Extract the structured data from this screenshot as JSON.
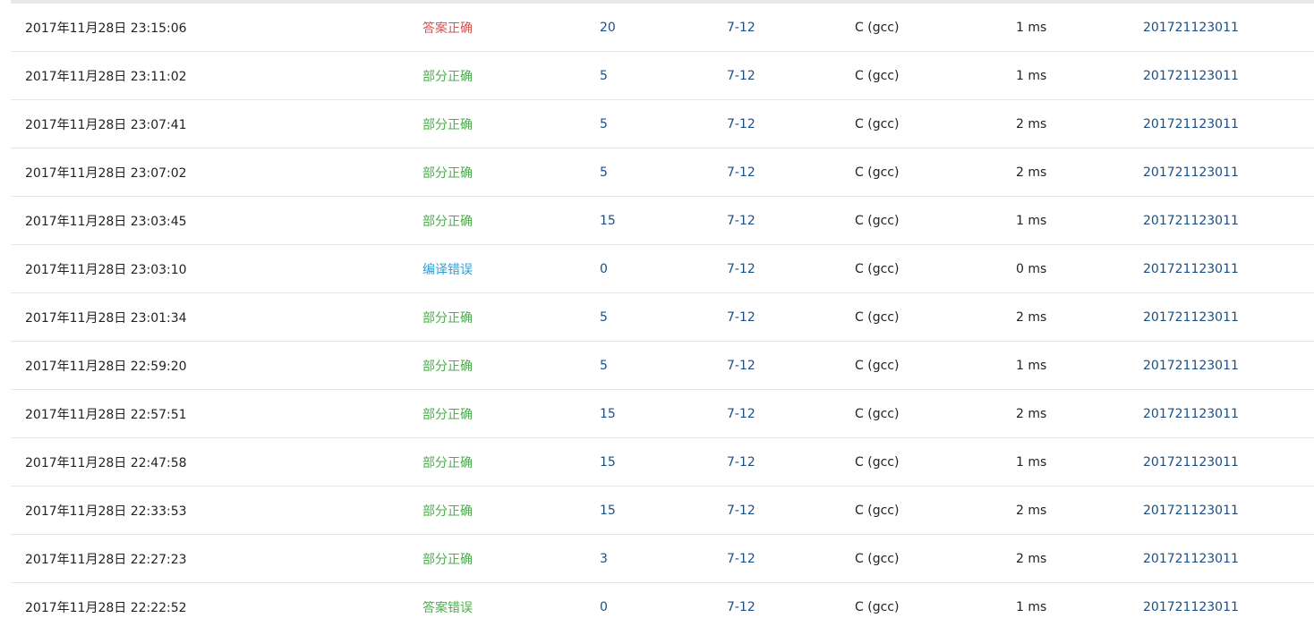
{
  "colors": {
    "status_correct": "#d9534f",
    "status_partial": "#4cae4c",
    "status_compile_error": "#2e9fd6",
    "status_wrong": "#4cae4c",
    "link": "#1a4f86",
    "text": "#222222",
    "row_border": "#e6e6e6"
  },
  "submissions": [
    {
      "time": "2017年11月28日 23:15:06",
      "status": "答案正确",
      "status_kind": "correct",
      "score": "20",
      "problem": "7-12",
      "compiler": "C (gcc)",
      "duration": "1 ms",
      "user": "201721123011"
    },
    {
      "time": "2017年11月28日 23:11:02",
      "status": "部分正确",
      "status_kind": "partial",
      "score": "5",
      "problem": "7-12",
      "compiler": "C (gcc)",
      "duration": "1 ms",
      "user": "201721123011"
    },
    {
      "time": "2017年11月28日 23:07:41",
      "status": "部分正确",
      "status_kind": "partial",
      "score": "5",
      "problem": "7-12",
      "compiler": "C (gcc)",
      "duration": "2 ms",
      "user": "201721123011"
    },
    {
      "time": "2017年11月28日 23:07:02",
      "status": "部分正确",
      "status_kind": "partial",
      "score": "5",
      "problem": "7-12",
      "compiler": "C (gcc)",
      "duration": "2 ms",
      "user": "201721123011"
    },
    {
      "time": "2017年11月28日 23:03:45",
      "status": "部分正确",
      "status_kind": "partial",
      "score": "15",
      "problem": "7-12",
      "compiler": "C (gcc)",
      "duration": "1 ms",
      "user": "201721123011"
    },
    {
      "time": "2017年11月28日 23:03:10",
      "status": "编译错误",
      "status_kind": "compile_error",
      "score": "0",
      "problem": "7-12",
      "compiler": "C (gcc)",
      "duration": "0 ms",
      "user": "201721123011"
    },
    {
      "time": "2017年11月28日 23:01:34",
      "status": "部分正确",
      "status_kind": "partial",
      "score": "5",
      "problem": "7-12",
      "compiler": "C (gcc)",
      "duration": "2 ms",
      "user": "201721123011"
    },
    {
      "time": "2017年11月28日 22:59:20",
      "status": "部分正确",
      "status_kind": "partial",
      "score": "5",
      "problem": "7-12",
      "compiler": "C (gcc)",
      "duration": "1 ms",
      "user": "201721123011"
    },
    {
      "time": "2017年11月28日 22:57:51",
      "status": "部分正确",
      "status_kind": "partial",
      "score": "15",
      "problem": "7-12",
      "compiler": "C (gcc)",
      "duration": "2 ms",
      "user": "201721123011"
    },
    {
      "time": "2017年11月28日 22:47:58",
      "status": "部分正确",
      "status_kind": "partial",
      "score": "15",
      "problem": "7-12",
      "compiler": "C (gcc)",
      "duration": "1 ms",
      "user": "201721123011"
    },
    {
      "time": "2017年11月28日 22:33:53",
      "status": "部分正确",
      "status_kind": "partial",
      "score": "15",
      "problem": "7-12",
      "compiler": "C (gcc)",
      "duration": "2 ms",
      "user": "201721123011"
    },
    {
      "time": "2017年11月28日 22:27:23",
      "status": "部分正确",
      "status_kind": "partial",
      "score": "3",
      "problem": "7-12",
      "compiler": "C (gcc)",
      "duration": "2 ms",
      "user": "201721123011"
    },
    {
      "time": "2017年11月28日 22:22:52",
      "status": "答案错误",
      "status_kind": "wrong",
      "score": "0",
      "problem": "7-12",
      "compiler": "C (gcc)",
      "duration": "1 ms",
      "user": "201721123011"
    }
  ]
}
